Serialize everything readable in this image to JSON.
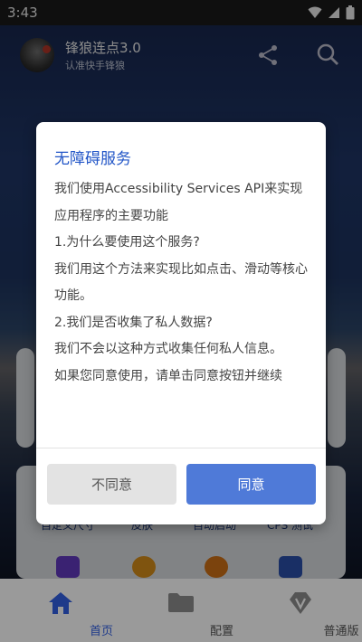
{
  "status_bar": {
    "time": "3:43"
  },
  "header": {
    "app_title": "锋狼连点3.0",
    "subtitle": "认准快手锋狼"
  },
  "features": [
    "自定义尺寸",
    "皮肤",
    "自动启动",
    "CPS 测试"
  ],
  "dialog": {
    "title": "无障碍服务",
    "paragraphs": [
      "我们使用Accessibility Services API来实现应用程序的主要功能",
      "1.为什么要使用这个服务?",
      "我们用这个方法来实现比如点击、滑动等核心功能。",
      "2.我们是否收集了私人数据?",
      "我们不会以这种方式收集任何私人信息。",
      "如果您同意使用，请单击同意按钮并继续"
    ],
    "decline_label": "不同意",
    "accept_label": "同意"
  },
  "bottom_nav": [
    {
      "label": "首页",
      "icon": "home-icon"
    },
    {
      "label": "配置",
      "icon": "folder-icon"
    },
    {
      "label": "普通版",
      "icon": "diamond-v-icon"
    }
  ],
  "colors": {
    "accent": "#2155c7",
    "accept_button": "#4f7ad8",
    "nav_active": "#1e3a8a"
  }
}
